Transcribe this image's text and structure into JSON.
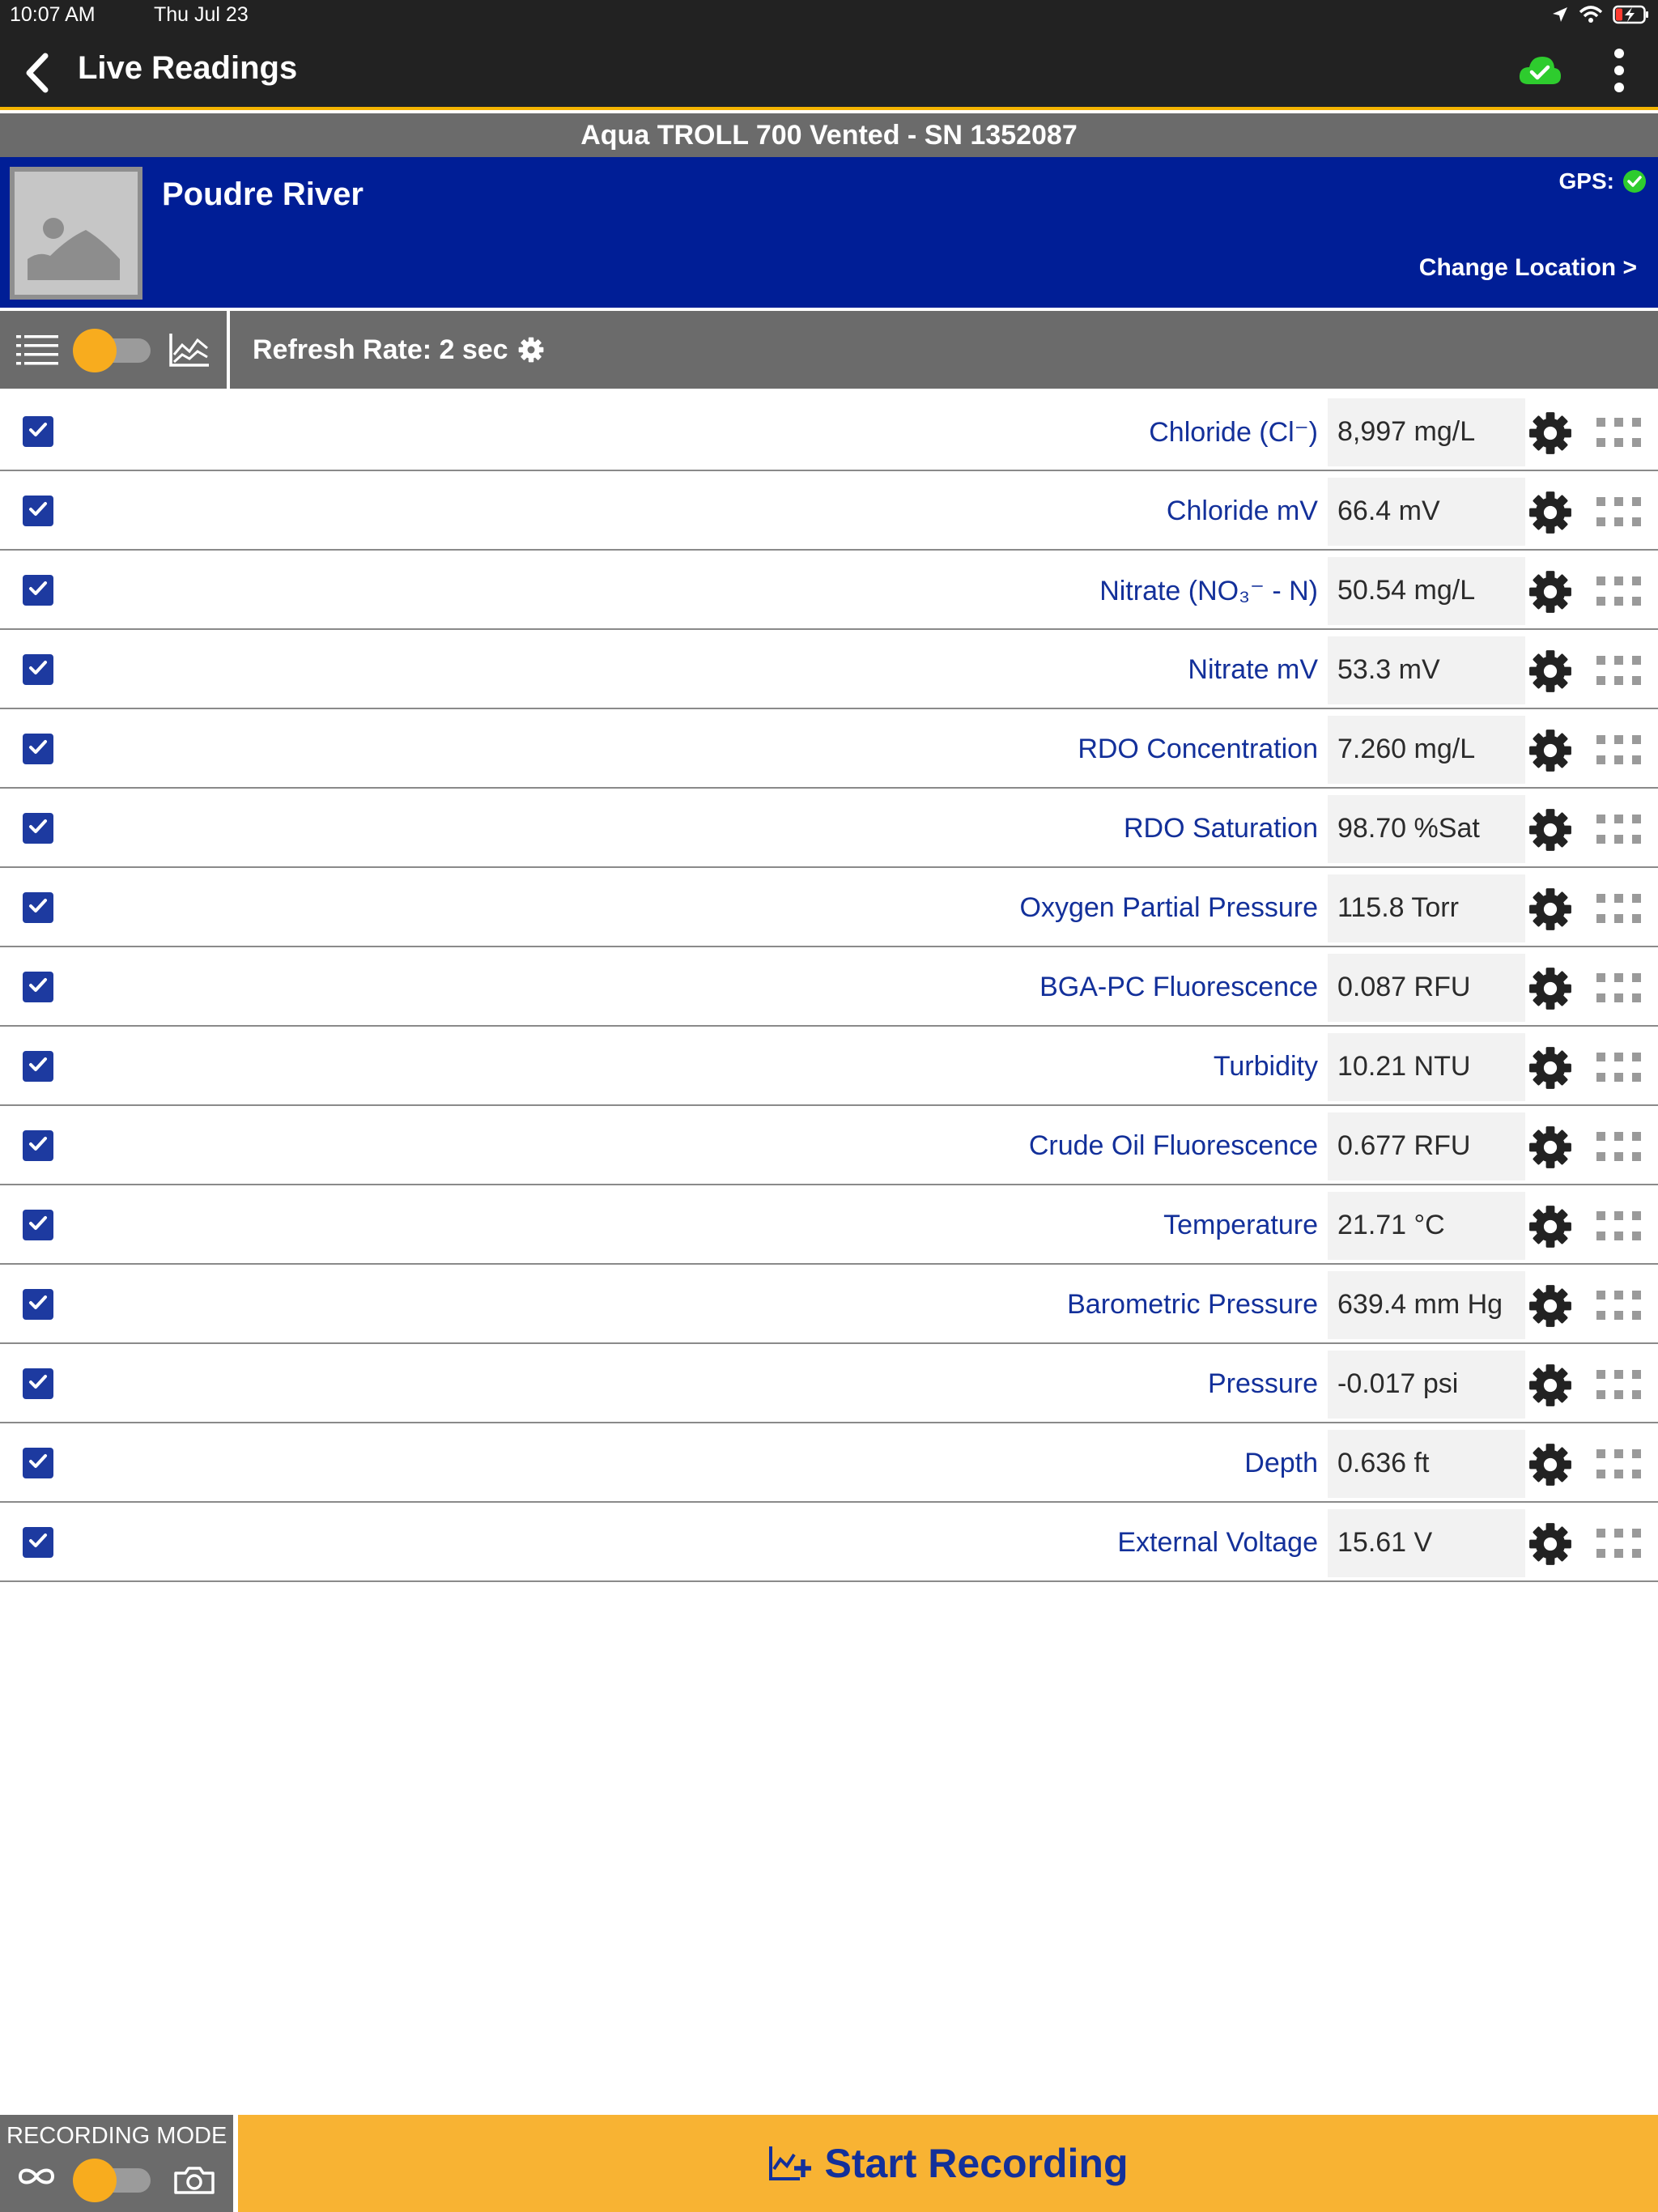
{
  "status_bar": {
    "time": "10:07 AM",
    "date": "Thu Jul 23"
  },
  "header": {
    "title": "Live Readings"
  },
  "device": {
    "name": "Aqua TROLL 700 Vented - SN 1352087"
  },
  "location": {
    "name": "Poudre River",
    "gps_label": "GPS:",
    "change_label": "Change Location >"
  },
  "toolbar": {
    "refresh_label": "Refresh Rate: 2 sec"
  },
  "parameters": [
    {
      "name": "Chloride (Cl⁻)",
      "value": "8,997 mg/L",
      "checked": true
    },
    {
      "name": "Chloride mV",
      "value": "66.4 mV",
      "checked": true
    },
    {
      "name": "Nitrate (NO₃⁻ - N)",
      "value": "50.54 mg/L",
      "checked": true
    },
    {
      "name": "Nitrate mV",
      "value": "53.3 mV",
      "checked": true
    },
    {
      "name": "RDO Concentration",
      "value": "7.260 mg/L",
      "checked": true
    },
    {
      "name": "RDO Saturation",
      "value": "98.70 %Sat",
      "checked": true
    },
    {
      "name": "Oxygen Partial Pressure",
      "value": "115.8 Torr",
      "checked": true
    },
    {
      "name": "BGA-PC Fluorescence",
      "value": "0.087 RFU",
      "checked": true
    },
    {
      "name": "Turbidity",
      "value": "10.21 NTU",
      "checked": true
    },
    {
      "name": "Crude Oil Fluorescence",
      "value": "0.677 RFU",
      "checked": true
    },
    {
      "name": "Temperature",
      "value": "21.71 °C",
      "checked": true
    },
    {
      "name": "Barometric Pressure",
      "value": "639.4 mm Hg",
      "checked": true
    },
    {
      "name": "Pressure",
      "value": "-0.017 psi",
      "checked": true
    },
    {
      "name": "Depth",
      "value": "0.636 ft",
      "checked": true
    },
    {
      "name": "External Voltage",
      "value": "15.61 V",
      "checked": true
    }
  ],
  "bottom": {
    "recording_mode_label": "RECORDING MODE",
    "start_label": "Start Recording"
  },
  "colors": {
    "accent": "#f8b333",
    "header": "#222222",
    "location_bar": "#001e96",
    "label_text": "#13309a",
    "cloud_ok": "#2ecc2e"
  }
}
